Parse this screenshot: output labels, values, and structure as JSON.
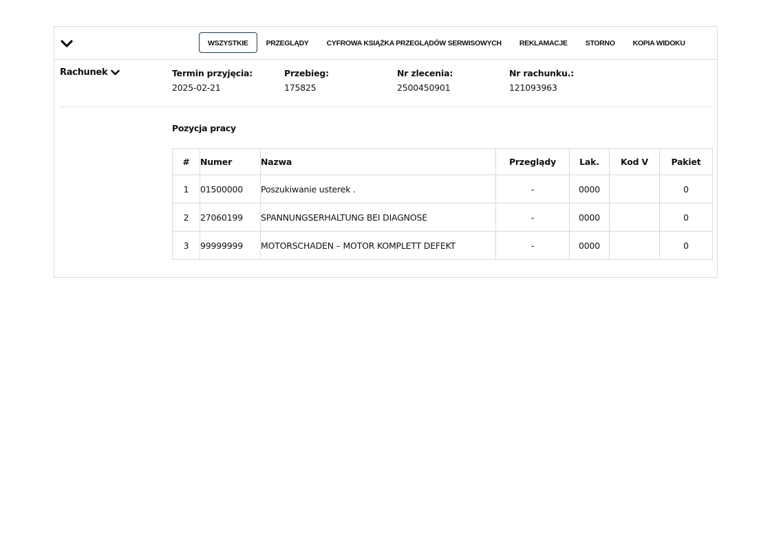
{
  "tabs": [
    {
      "label": "WSZYSTKIE",
      "active": true
    },
    {
      "label": "PRZEGLĄDY",
      "active": false
    },
    {
      "label": "CYFROWA KSIĄŻKA PRZEGLĄDÓW SERWISOWYCH",
      "active": false
    },
    {
      "label": "REKLAMACJE",
      "active": false
    },
    {
      "label": "STORNO",
      "active": false
    },
    {
      "label": "KOPIA WIDOKU",
      "active": false
    }
  ],
  "section": {
    "label": "Rachunek",
    "icon": "chevron-down-icon"
  },
  "collapse_icon": "chevron-down-icon",
  "fields": {
    "termin": {
      "label": "Termin przyjęcia:",
      "value": "2025-02-21"
    },
    "przebieg": {
      "label": "Przebieg:",
      "value": "175825"
    },
    "zlecenie": {
      "label": "Nr zlecenia:",
      "value": "2500450901"
    },
    "rachunek": {
      "label": "Nr rachunku.:",
      "value": "121093963"
    }
  },
  "work_items": {
    "title": "Pozycja pracy",
    "columns": [
      "#",
      "Numer",
      "Nazwa",
      "Przeglądy",
      "Lak.",
      "Kod V",
      "Pakiet"
    ],
    "rows": [
      [
        "1",
        "01500000",
        "Poszukiwanie usterek .",
        "-",
        "0000",
        "",
        "0"
      ],
      [
        "2",
        "27060199",
        "SPANNUNGSERHALTUNG BEI DIAGNOSE",
        "-",
        "0000",
        "",
        "0"
      ],
      [
        "3",
        "99999999",
        "MOTORSCHADEN – MOTOR KOMPLETT DEFEKT",
        "-",
        "0000",
        "",
        "0"
      ]
    ]
  },
  "colors": {
    "border": "#d9d9d9",
    "active_tab_border": "#1f3a4a",
    "text": "#111111"
  }
}
